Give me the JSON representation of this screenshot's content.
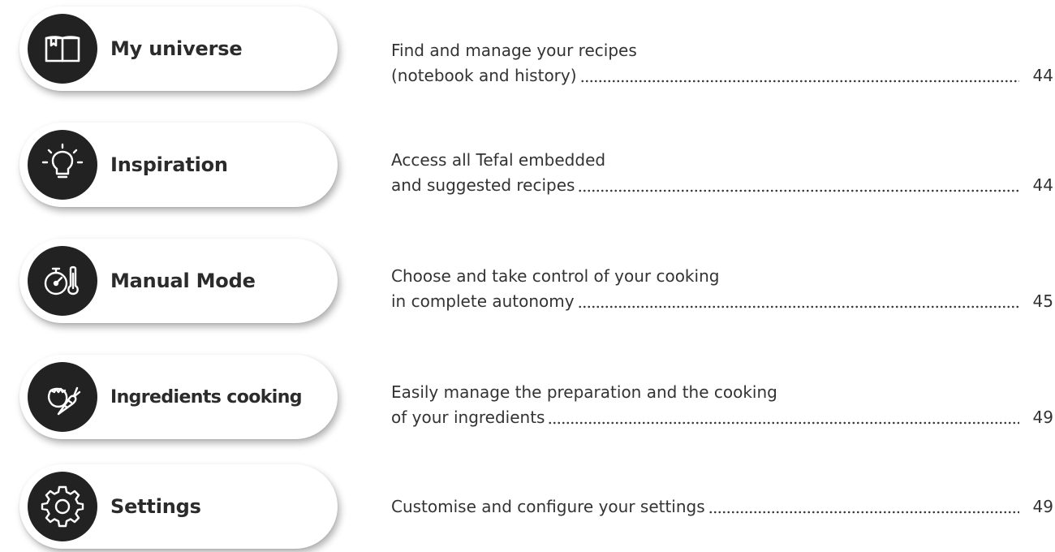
{
  "menu": [
    {
      "label": "My universe",
      "icon": "open-book-icon",
      "desc_line1": "Find and manage your recipes",
      "desc_line2": "(notebook and history)",
      "page": "44"
    },
    {
      "label": "Inspiration",
      "icon": "light-bulb-icon",
      "desc_line1": "Access all Tefal embedded",
      "desc_line2": "and suggested recipes",
      "page": "44"
    },
    {
      "label": "Manual Mode",
      "icon": "timer-thermometer-icon",
      "desc_line1": "Choose and take control of your cooking",
      "desc_line2": "in complete autonomy",
      "page": "45"
    },
    {
      "label": "Ingredients cooking",
      "icon": "tomato-carrot-icon",
      "desc_line1": "Easily manage the preparation and the cooking",
      "desc_line2": "of your ingredients",
      "page": "49"
    },
    {
      "label": "Settings",
      "icon": "gear-icon",
      "desc_line1": "",
      "desc_line2": "Customise and configure your settings",
      "page": "49"
    }
  ],
  "colors": {
    "icon_background": "#222222",
    "icon_stroke": "#ffffff",
    "text": "#2b2b2b",
    "pill_background": "#ffffff"
  }
}
